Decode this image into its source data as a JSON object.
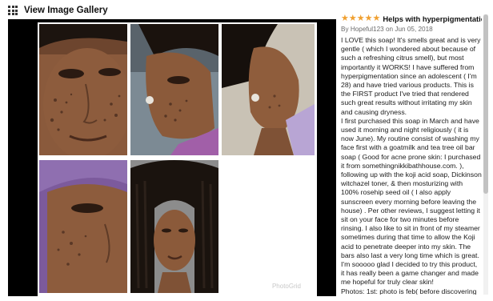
{
  "gallery": {
    "title": "View Image Gallery",
    "watermark": "PhotoGrid"
  },
  "review": {
    "rating": 5,
    "title": "Helps with hyperpigmentation!",
    "meta": "By Hopeful123 on Jun 05, 2018",
    "paragraphs": [
      "I LOVE this soap! It's smells great and is very gentle ( which I wondered about because of such a refreshing citrus smell), but most importantly it WORKS! I have suffered from hyperpigmentation since an adolescent ( I'm 28) and have tried various products. This is the FIRST product I've tried that rendered such great results without irritating my skin and causing dryness.",
      "I first purchased this soap in March and have used it morning and night religiously ( it is now June). My routine consist of washing my face first with a goatmilk and tea tree oil bar soap ( Good for acne prone skin: I purchased it from somethingnikkibathhouse.com. ), following up with the koji acid soap, Dickinson witchazel toner, & then mosturizing with 100% rosehip seed oil ( I also apply sunscreen every morning before leaving the house) . Per other reviews, I suggest letting it sit on your face for two minutes before rinsing. I also like to sit in front of my steamer sometimes during that time to allow the Koji acid to penetrate deeper into my skin. The bars also last a very long time which is great. I'm sooooo glad I decided to try this product, it has really been a game changer and made me hopeful for truly clear skin!",
      "Photos: 1st: photo is feb( before discovering"
    ]
  },
  "colors": {
    "star": "#f0a030",
    "viewer_bg": "#000000",
    "meta_text": "#6b6b6b"
  },
  "icons": {
    "gallery": "grid-icon",
    "rating": "star-icon"
  }
}
